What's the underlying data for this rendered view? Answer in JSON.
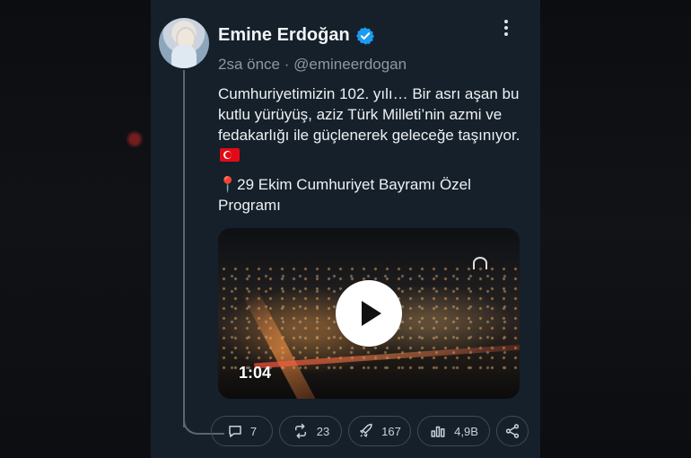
{
  "tweet": {
    "author_name": "Emine Erdoğan",
    "time": "2sa önce",
    "separator": "·",
    "handle": "@emineerdogan",
    "paragraph1": "Cumhuriyetimizin 102. yılı… Bir asrı aşan bu kutlu yürüyüş, aziz Türk Milleti’nin azmi ve fedakarlığı ile güçlenerek geleceğe taşınıyor.",
    "paragraph2_pin": "📍",
    "paragraph2": "29 Ekim Cumhuriyet Bayramı Özel Programı",
    "video_duration": "1:04"
  },
  "actions": {
    "replies": "7",
    "retweets": "23",
    "likes": "167",
    "views": "4,9B"
  },
  "icons": {
    "verified": "verified-badge-icon",
    "more": "more-vertical-icon",
    "reply": "comment-icon",
    "retweet": "retweet-icon",
    "like": "rocket-icon",
    "views": "views-bar-icon",
    "share": "share-icon",
    "flag": "turkey-flag-icon",
    "play": "play-icon"
  },
  "colors": {
    "card_bg": "#15202b",
    "verified": "#1d9bf0",
    "muted_text": "#8b98a5",
    "flag_red": "#e30a17"
  }
}
